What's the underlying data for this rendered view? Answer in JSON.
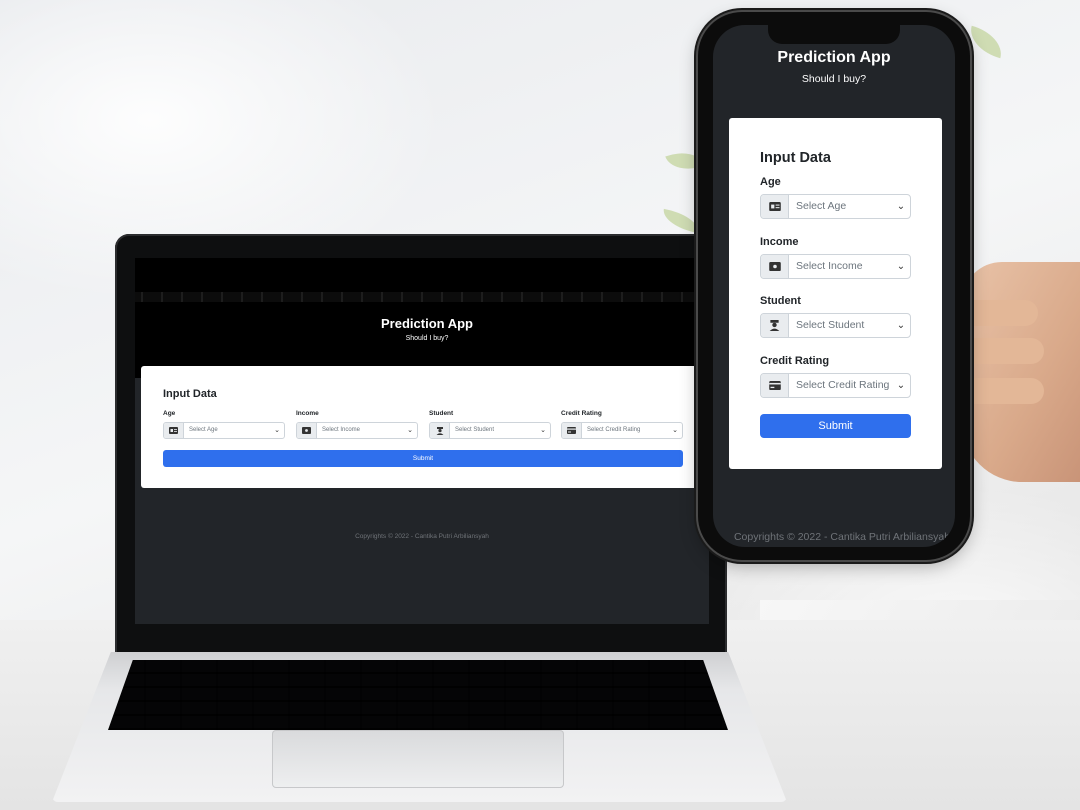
{
  "app": {
    "title": "Prediction App",
    "subtitle": "Should I buy?"
  },
  "form": {
    "title": "Input Data",
    "fields": [
      {
        "label": "Age",
        "placeholder": "Select Age",
        "icon": "id-card-icon"
      },
      {
        "label": "Income",
        "placeholder": "Select Income",
        "icon": "money-icon"
      },
      {
        "label": "Student",
        "placeholder": "Select Student",
        "icon": "student-icon"
      },
      {
        "label": "Credit Rating",
        "placeholder": "Select Credit Rating",
        "icon": "credit-card-icon"
      }
    ],
    "submit_label": "Submit"
  },
  "footer": {
    "text": "Copyrights © 2022 - Cantika Putri Arbiliansyah"
  },
  "colors": {
    "background": "#222529",
    "hero": "#000000",
    "card": "#ffffff",
    "accent": "#2f6fed",
    "footer_text": "#6f7378"
  }
}
